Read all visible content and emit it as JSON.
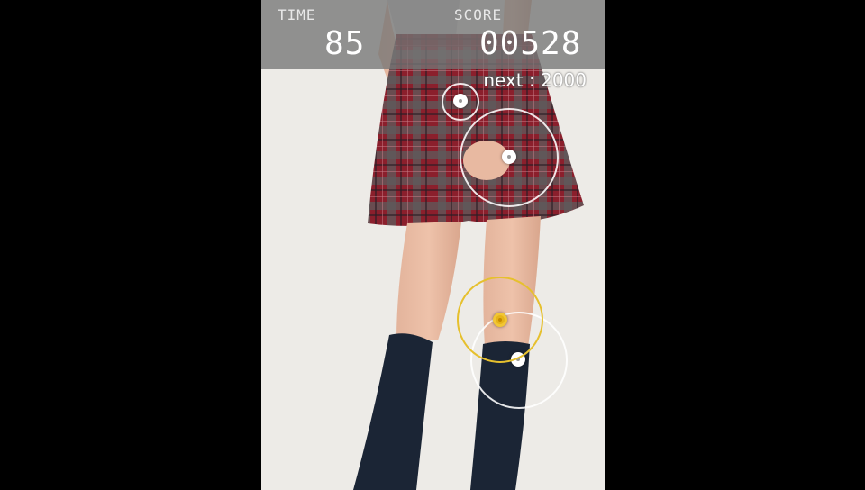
{
  "hud": {
    "time_label": "TIME",
    "time_value": "85",
    "score_label": "SCORE",
    "score_value": "00528",
    "next_text": "next : 2000"
  },
  "colors": {
    "active_target": "#e6c02e",
    "idle_target": "#ffffff",
    "hud_background": "#767676"
  },
  "targets": [
    {
      "name": "target-small-upper",
      "state": "idle"
    },
    {
      "name": "target-skirt",
      "state": "idle"
    },
    {
      "name": "target-knee-active",
      "state": "active"
    },
    {
      "name": "target-shin",
      "state": "idle"
    }
  ]
}
